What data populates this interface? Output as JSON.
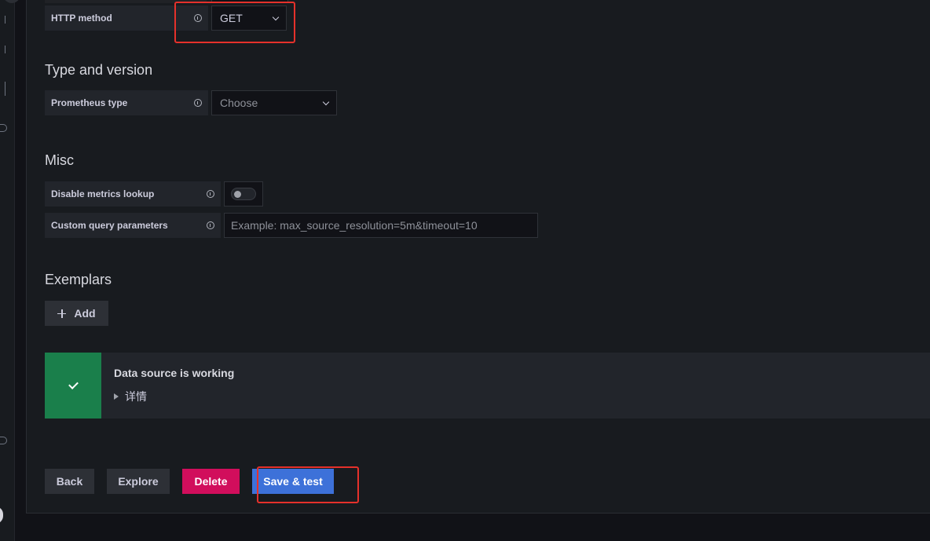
{
  "http_method": {
    "label": "HTTP method",
    "value": "GET"
  },
  "type_and_version": {
    "title": "Type and version",
    "prometheus_type_label": "Prometheus type",
    "prometheus_type_placeholder": "Choose"
  },
  "misc": {
    "title": "Misc",
    "disable_metrics_lookup_label": "Disable metrics lookup",
    "disable_metrics_lookup_enabled": false,
    "custom_query_parameters_label": "Custom query parameters",
    "custom_query_parameters_placeholder": "Example: max_source_resolution=5m&timeout=10",
    "custom_query_parameters_value": ""
  },
  "exemplars": {
    "title": "Exemplars",
    "add_label": "Add"
  },
  "alert": {
    "status": "success",
    "title": "Data source is working",
    "details_label": "详情"
  },
  "actions": {
    "back_label": "Back",
    "explore_label": "Explore",
    "delete_label": "Delete",
    "save_test_label": "Save & test"
  },
  "colors": {
    "success": "#1a7f4b",
    "danger": "#d10e5c",
    "primary": "#3d71d9",
    "annotation": "#e5312b"
  }
}
